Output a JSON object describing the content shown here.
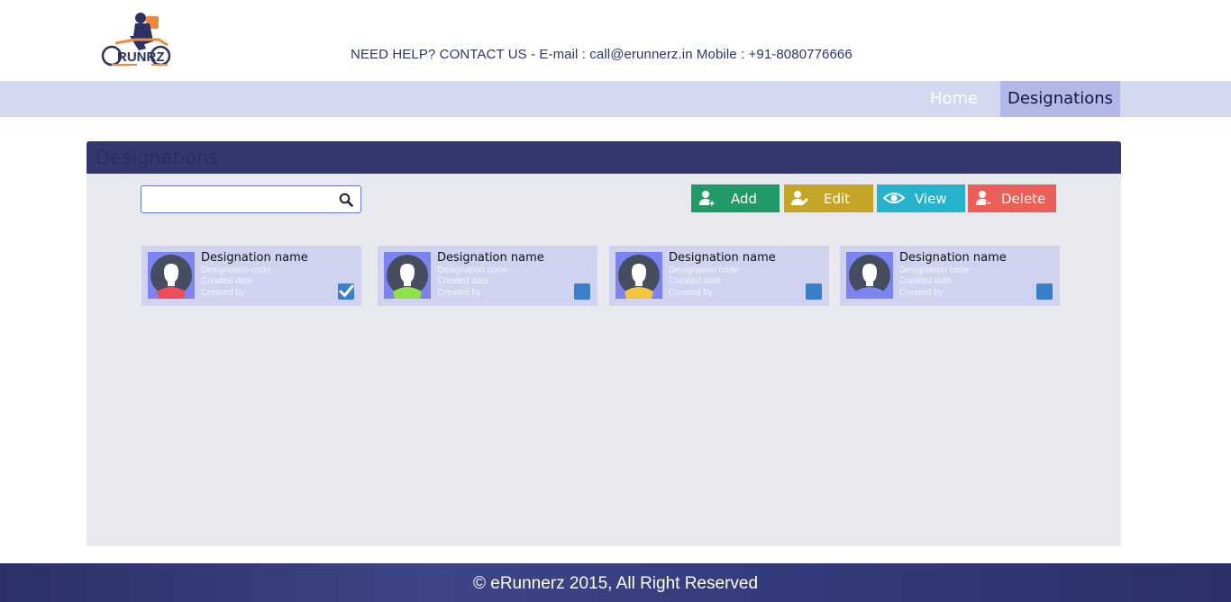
{
  "header": {
    "logo_text": "RUNRZ",
    "help_text": "NEED HELP? CONTACT US - E-mail : call@erunnerz.in Mobile : +91-8080776666"
  },
  "nav": {
    "home_label": "Home",
    "designations_label": "Designations"
  },
  "panel": {
    "title": "Designations",
    "search": {
      "value": "",
      "placeholder": ""
    },
    "buttons": {
      "add": "Add",
      "edit": "Edit",
      "view": "View",
      "delete": "Delete"
    },
    "cards": [
      {
        "name": "Designation name",
        "code": "Designation code",
        "created_date": "Created date",
        "created_by": "Created by",
        "checked": true,
        "shirt_color": "#f04e5a"
      },
      {
        "name": "Designation name",
        "code": "Designation code",
        "created_date": "Created date",
        "created_by": "Created by",
        "checked": false,
        "shirt_color": "#8ee34a"
      },
      {
        "name": "Designation name",
        "code": "Designation code",
        "created_date": "Created date",
        "created_by": "Created by",
        "checked": false,
        "shirt_color": "#f2c640"
      },
      {
        "name": "Designation name",
        "code": "Designation code",
        "created_date": "Created date",
        "created_by": "Created by",
        "checked": false,
        "shirt_color": "#7b84f0"
      }
    ]
  },
  "footer": {
    "text": "© eRunnerz 2015, All Right Reserved"
  },
  "colors": {
    "navbar": "#d4d8f1",
    "nav_active": "#b2b9e8",
    "panel_header": "#32386d",
    "add": "#1f9a68",
    "edit": "#c5a528",
    "view": "#26b3ce",
    "delete": "#ec5f57",
    "checkbox": "#3b7fc9"
  }
}
